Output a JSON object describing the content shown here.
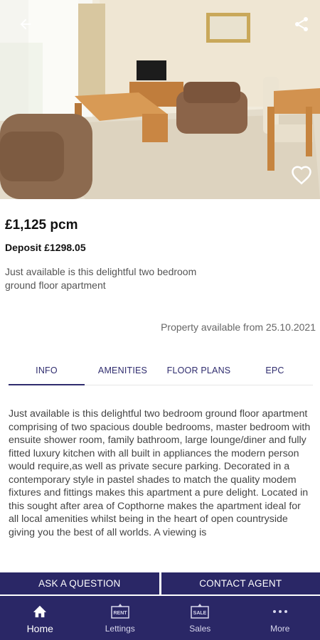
{
  "listing": {
    "price": "£1,125 pcm",
    "deposit": "Deposit £1298.05",
    "summary": "Just available is this delightful two bedroom ground floor apartment",
    "available_from": "Property available from 25.10.2021",
    "description": "Just available is this delightful two bedroom ground floor apartment comprising of two spacious double bedrooms, master bedroom with ensuite shower room, family bathroom, large lounge/diner and fully fitted luxury kitchen with all built in appliances the modern person would require,as well as private secure parking. Decorated in a contemporary style in pastel shades to match the quality modem fixtures and fittings makes this apartment a pure delight. Located in this sought after area of Copthorne makes the apartment ideal for all local amenities whilst being in the heart of open countryside giving you the best of all worlds. A viewing is"
  },
  "tabs": [
    {
      "label": "INFO",
      "active": true
    },
    {
      "label": "AMENITIES",
      "active": false
    },
    {
      "label": "FLOOR PLANS",
      "active": false
    },
    {
      "label": "EPC",
      "active": false
    }
  ],
  "actions": {
    "ask": "ASK A QUESTION",
    "contact": "CONTACT AGENT"
  },
  "bottom_nav": [
    {
      "label": "Home",
      "icon": "home-icon",
      "active": true
    },
    {
      "label": "Lettings",
      "icon": "rent-sign-icon",
      "active": false
    },
    {
      "label": "Sales",
      "icon": "sale-sign-icon",
      "active": false
    },
    {
      "label": "More",
      "icon": "more-dots-icon",
      "active": false
    }
  ],
  "icons": {
    "back": "arrow-back-icon",
    "share": "share-icon",
    "favorite": "heart-outline-icon"
  },
  "colors": {
    "brand": "#2a2766",
    "tab_text": "#2f2c6e"
  }
}
